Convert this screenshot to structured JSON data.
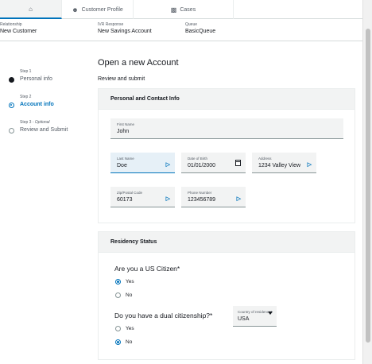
{
  "tabs": [
    {
      "label": "",
      "icon": "home-icon"
    },
    {
      "label": "Customer Profile",
      "icon": "profile-icon"
    },
    {
      "label": "Cases",
      "icon": "cases-icon"
    }
  ],
  "attributes": [
    {
      "key": "Relationship",
      "value": "New Customer"
    },
    {
      "key": "IVR Response",
      "value": "New Savings Account"
    },
    {
      "key": "Queue",
      "value": "BasicQueue"
    }
  ],
  "steps": [
    {
      "label": "Step 1",
      "optional": "",
      "name": "Personal info",
      "state": "done"
    },
    {
      "label": "Step 2",
      "optional": "",
      "name": "Account info",
      "state": "active"
    },
    {
      "label": "Step 3 - ",
      "optional": "Optional",
      "name": "Review and Submit",
      "state": "todo"
    }
  ],
  "page": {
    "title": "Open a new Account",
    "subtitle": "Review and submit"
  },
  "personal": {
    "header": "Personal and Contact Info",
    "first_name": {
      "label": "First Name",
      "value": "John"
    },
    "last_name": {
      "label": "Last Name",
      "value": "Doe"
    },
    "dob": {
      "label": "Date of Birth",
      "value": "01/01/2000"
    },
    "address": {
      "label": "Address",
      "value": "1234 Valley View"
    },
    "zip": {
      "label": "Zip/Postal Code",
      "value": "60173"
    },
    "phone": {
      "label": "Phone Number",
      "value": "123456789"
    }
  },
  "residency": {
    "header": "Residency Status",
    "q1": "Are you a US Citizen*",
    "q1_yes": "Yes",
    "q1_no": "No",
    "q1_selected": "Yes",
    "q2": "Do you have a dual citizenship?*",
    "q2_yes": "Yes",
    "q2_no": "No",
    "q2_selected": "No",
    "country": {
      "label": "Country of residence*",
      "value": "USA"
    }
  },
  "colors": {
    "accent": "#0073bb",
    "text": "#16191f",
    "muted": "#545b64"
  }
}
